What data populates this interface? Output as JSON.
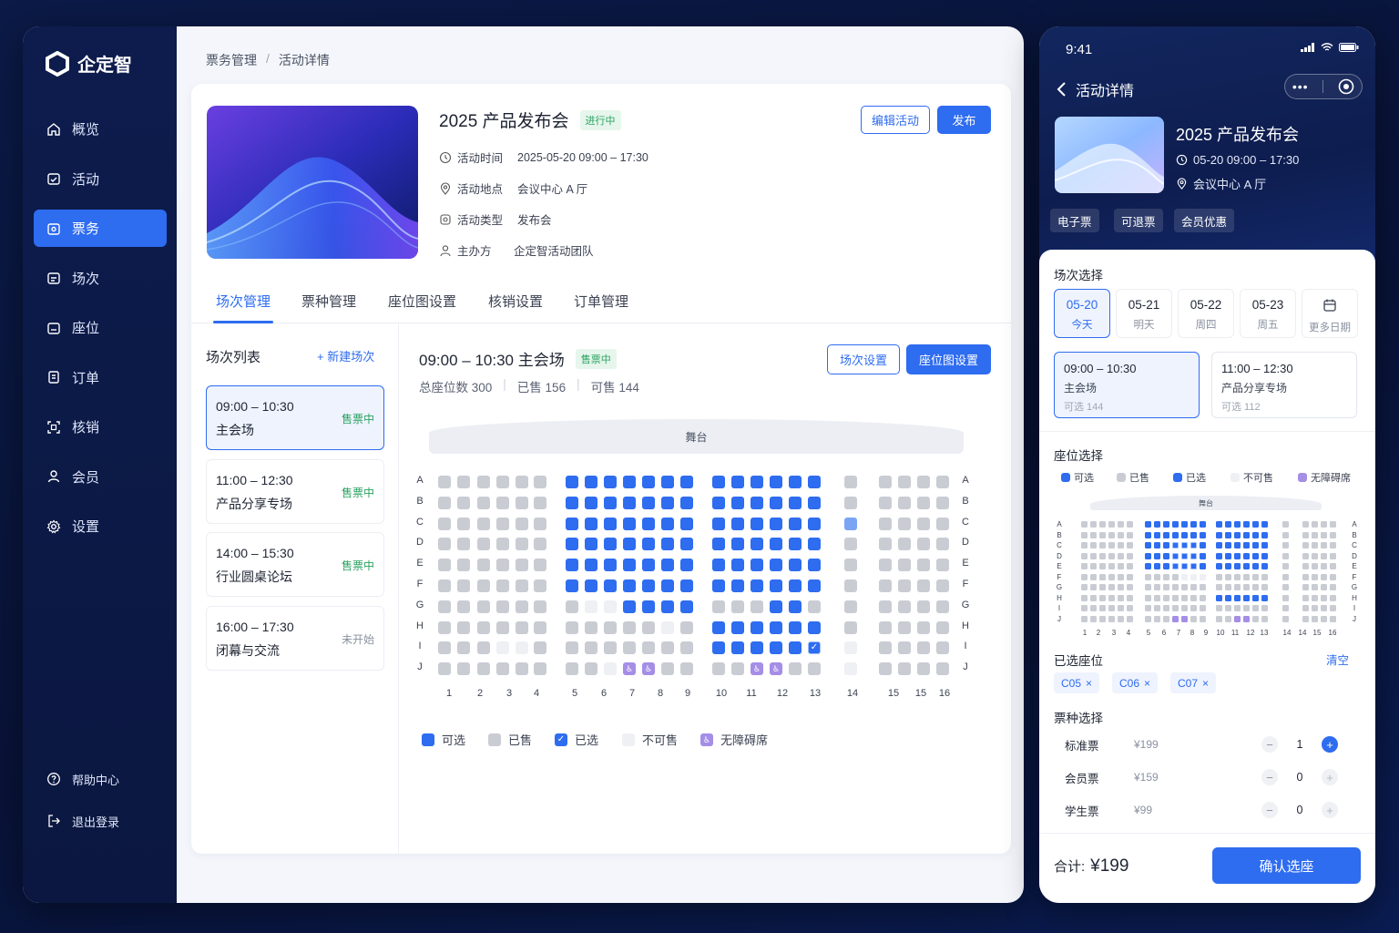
{
  "app": {
    "name": "企定智"
  },
  "nav": [
    {
      "label": "概览",
      "icon": "home-icon"
    },
    {
      "label": "活动",
      "icon": "calendar-check-icon"
    },
    {
      "label": "票务",
      "icon": "ticket-icon",
      "active": true
    },
    {
      "label": "场次",
      "icon": "schedule-icon"
    },
    {
      "label": "座位",
      "icon": "seat-icon"
    },
    {
      "label": "订单",
      "icon": "order-icon"
    },
    {
      "label": "核销",
      "icon": "scan-icon"
    },
    {
      "label": "会员",
      "icon": "user-icon"
    },
    {
      "label": "设置",
      "icon": "gear-icon"
    }
  ],
  "side_bottom": {
    "help": "帮助中心",
    "logout": "退出登录"
  },
  "breadcrumb": {
    "root": "票务管理",
    "sep": "/",
    "current": "活动详情"
  },
  "event": {
    "title": "2025 产品发布会",
    "status": "进行中",
    "time_label": "活动时间",
    "time": "2025-05-20 09:00 – 17:30",
    "place_label": "活动地点",
    "place": "会议中心 A 厅",
    "type_label": "活动类型",
    "type": "发布会",
    "host_label": "主办方",
    "host": "企定智活动团队",
    "edit_btn": "编辑活动",
    "publish_btn": "发布"
  },
  "tabs": [
    "场次管理",
    "票种管理",
    "座位图设置",
    "核销设置",
    "订单管理"
  ],
  "session_list": {
    "title": "场次列表",
    "new_btn": "+ 新建场次",
    "items": [
      {
        "time": "09:00 – 10:30",
        "name": "主会场",
        "status": "售票中"
      },
      {
        "time": "11:00 – 12:30",
        "name": "产品分享专场",
        "status": "售票中"
      },
      {
        "time": "14:00 – 15:30",
        "name": "行业圆桌论坛",
        "status": "售票中"
      },
      {
        "time": "16:00 – 17:30",
        "name": "闭幕与交流",
        "status": "未开始"
      }
    ]
  },
  "session_detail": {
    "title": "09:00 – 10:30  主会场",
    "status": "售票中",
    "total": "总座位数 300",
    "sold": "已售 156",
    "avail": "可售 144",
    "settings_btn": "场次设置",
    "seatmap_btn": "座位图设置",
    "stage": "舞台"
  },
  "seatmap": {
    "rows": [
      "A",
      "B",
      "C",
      "D",
      "E",
      "F",
      "G",
      "H",
      "I",
      "J"
    ],
    "cols": [
      "1",
      "2",
      "3",
      "4",
      "5",
      "6",
      "7",
      "8",
      "9",
      "10",
      "11",
      "12",
      "13",
      "14",
      "15",
      "15",
      "16"
    ]
  },
  "legend": {
    "available": "可选",
    "sold": "已售",
    "selected": "已选",
    "unavailable": "不可售",
    "accessible": "无障碍席"
  },
  "phone": {
    "time": "9:41",
    "back_title": "活动详情",
    "title": "2025 产品发布会",
    "time_range": "05-20 09:00 – 17:30",
    "place": "会议中心 A 厅",
    "tags": [
      "电子票",
      "可退票",
      "会员优惠"
    ],
    "session_header": "场次选择",
    "dates": [
      {
        "d": "05-20",
        "w": "今天"
      },
      {
        "d": "05-21",
        "w": "明天"
      },
      {
        "d": "05-22",
        "w": "周四"
      },
      {
        "d": "05-23",
        "w": "周五"
      },
      {
        "d": "",
        "w": "更多日期"
      }
    ],
    "sessions": [
      {
        "time": "09:00 – 10:30",
        "name": "主会场",
        "left": "可选 144"
      },
      {
        "time": "11:00 – 12:30",
        "name": "产品分享专场",
        "left": "可选 112"
      }
    ],
    "seat_header": "座位选择",
    "legend": [
      "可选",
      "已售",
      "已选",
      "不可售",
      "无障碍席"
    ],
    "stage": "舞台",
    "cols": [
      "1",
      "2",
      "3",
      "4",
      "5",
      "6",
      "7",
      "8",
      "9",
      "10",
      "11",
      "12",
      "13",
      "14",
      "14",
      "15",
      "16"
    ],
    "selected_header": "已选座位",
    "clear": "清空",
    "selected": [
      "C05",
      "C06",
      "C07"
    ],
    "ticket_header": "票种选择",
    "tickets": [
      {
        "name": "标准票",
        "price": "¥199",
        "qty": "1"
      },
      {
        "name": "会员票",
        "price": "¥159",
        "qty": "0"
      },
      {
        "name": "学生票",
        "price": "¥99",
        "qty": "0"
      }
    ],
    "total_label": "合计:",
    "total": "¥199",
    "confirm": "确认选座"
  },
  "colors": {
    "accent": "#2e6cf0",
    "sidebar": "#0d1c4d",
    "success": "#2aa260"
  }
}
